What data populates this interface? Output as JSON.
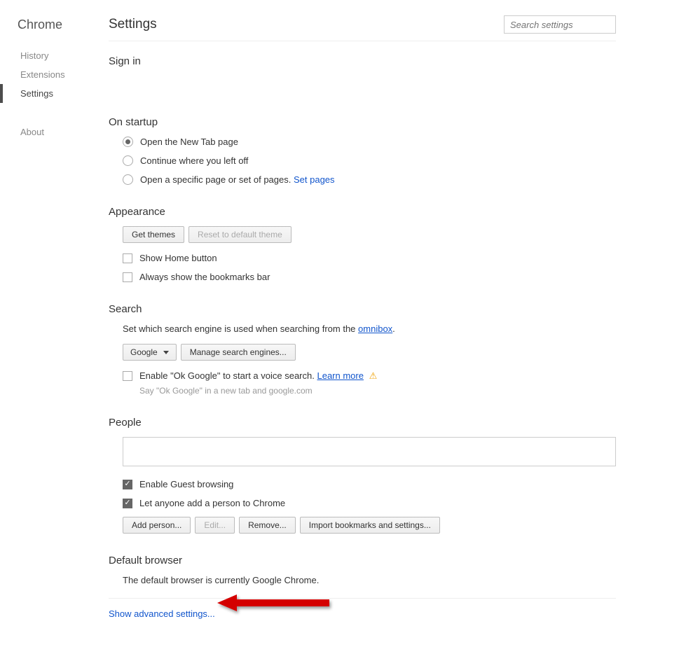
{
  "sidebar": {
    "title": "Chrome",
    "items": [
      "History",
      "Extensions",
      "Settings"
    ],
    "about": "About",
    "active_index": 2
  },
  "header": {
    "title": "Settings",
    "search_placeholder": "Search settings"
  },
  "signin": {
    "title": "Sign in"
  },
  "startup": {
    "title": "On startup",
    "opt_newtab": "Open the New Tab page",
    "opt_continue": "Continue where you left off",
    "opt_specific": "Open a specific page or set of pages.",
    "set_pages": "Set pages"
  },
  "appearance": {
    "title": "Appearance",
    "get_themes": "Get themes",
    "reset_theme": "Reset to default theme",
    "show_home": "Show Home button",
    "show_bookmarks": "Always show the bookmarks bar"
  },
  "search": {
    "title": "Search",
    "desc_prefix": "Set which search engine is used when searching from the ",
    "omnibox": "omnibox",
    "engine": "Google",
    "manage": "Manage search engines...",
    "ok_google": "Enable \"Ok Google\" to start a voice search.",
    "learn_more": "Learn more",
    "ok_google_sub": "Say \"Ok Google\" in a new tab and google.com"
  },
  "people": {
    "title": "People",
    "guest": "Enable Guest browsing",
    "anyone_add": "Let anyone add a person to Chrome",
    "add_person": "Add person...",
    "edit": "Edit...",
    "remove": "Remove...",
    "import": "Import bookmarks and settings..."
  },
  "default_browser": {
    "title": "Default browser",
    "text": "The default browser is currently Google Chrome."
  },
  "advanced": {
    "label": "Show advanced settings..."
  }
}
